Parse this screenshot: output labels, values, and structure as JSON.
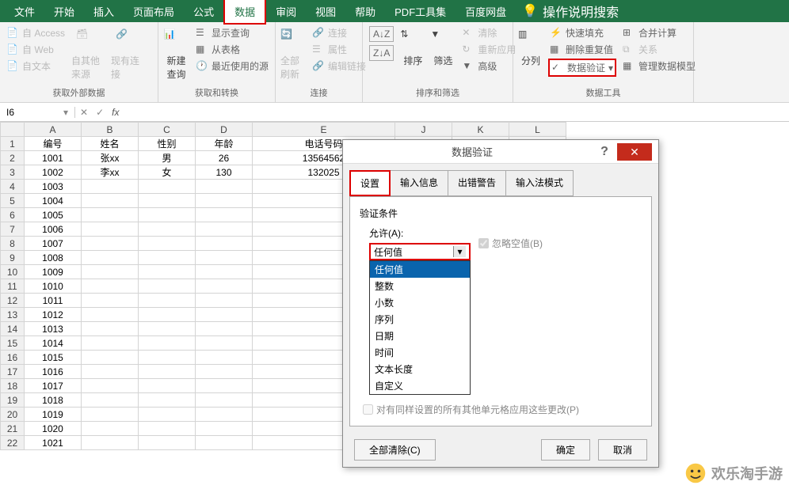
{
  "menu": {
    "items": [
      "文件",
      "开始",
      "插入",
      "页面布局",
      "公式",
      "数据",
      "审阅",
      "视图",
      "帮助",
      "PDF工具集",
      "百度网盘"
    ],
    "activeIndex": 5,
    "searchHint": "操作说明搜索"
  },
  "ribbon": {
    "groups": [
      {
        "label": "获取外部数据",
        "items1": [
          "自 Access",
          "自 Web",
          "自文本"
        ],
        "big1": "自其他来源",
        "big2": "现有连接"
      },
      {
        "label": "获取和转换",
        "big": "新建\n查询",
        "items": [
          "显示查询",
          "从表格",
          "最近使用的源"
        ]
      },
      {
        "label": "连接",
        "big": "全部刷新",
        "items": [
          "连接",
          "属性",
          "编辑链接"
        ]
      },
      {
        "label": "排序和筛选",
        "sortAsc": "A↓Z",
        "sortDesc": "Z↓A",
        "sort": "排序",
        "filter": "筛选",
        "items": [
          "清除",
          "重新应用",
          "高级"
        ]
      },
      {
        "label": "数据工具",
        "big": "分列",
        "items": [
          "快速填充",
          "删除重复值",
          "数据验证"
        ],
        "items2": [
          "合并计算",
          "关系",
          "管理数据模型"
        ]
      }
    ]
  },
  "nameBox": "I6",
  "sheet": {
    "columns": [
      "A",
      "B",
      "C",
      "D",
      "E",
      "J",
      "K",
      "L"
    ],
    "headers": [
      "编号",
      "姓名",
      "性别",
      "年龄",
      "电话号码"
    ],
    "rows": [
      [
        "1001",
        "张xx",
        "男",
        "26",
        "13564562"
      ],
      [
        "1002",
        "李xx",
        "女",
        "130",
        "132025"
      ],
      [
        "1003",
        "",
        "",
        "",
        ""
      ],
      [
        "1004",
        "",
        "",
        "",
        ""
      ],
      [
        "1005",
        "",
        "",
        "",
        ""
      ],
      [
        "1006",
        "",
        "",
        "",
        ""
      ],
      [
        "1007",
        "",
        "",
        "",
        ""
      ],
      [
        "1008",
        "",
        "",
        "",
        ""
      ],
      [
        "1009",
        "",
        "",
        "",
        ""
      ],
      [
        "1010",
        "",
        "",
        "",
        ""
      ],
      [
        "1011",
        "",
        "",
        "",
        ""
      ],
      [
        "1012",
        "",
        "",
        "",
        ""
      ],
      [
        "1013",
        "",
        "",
        "",
        ""
      ],
      [
        "1014",
        "",
        "",
        "",
        ""
      ],
      [
        "1015",
        "",
        "",
        "",
        ""
      ],
      [
        "1016",
        "",
        "",
        "",
        ""
      ],
      [
        "1017",
        "",
        "",
        "",
        ""
      ],
      [
        "1018",
        "",
        "",
        "",
        ""
      ],
      [
        "1019",
        "",
        "",
        "",
        ""
      ],
      [
        "1020",
        "",
        "",
        "",
        ""
      ],
      [
        "1021",
        "",
        "",
        "",
        ""
      ]
    ]
  },
  "dialog": {
    "title": "数据验证",
    "tabs": [
      "设置",
      "输入信息",
      "出错警告",
      "输入法模式"
    ],
    "activeTab": 0,
    "sectionLabel": "验证条件",
    "allowLabel": "允许(A):",
    "allowValue": "任何值",
    "allowOptions": [
      "任何值",
      "整数",
      "小数",
      "序列",
      "日期",
      "时间",
      "文本长度",
      "自定义"
    ],
    "ignoreBlank": "忽略空值(B)",
    "applyAll": "对有同样设置的所有其他单元格应用这些更改(P)",
    "clearAll": "全部清除(C)",
    "ok": "确定",
    "cancel": "取消"
  },
  "watermark": "欢乐淘手游"
}
